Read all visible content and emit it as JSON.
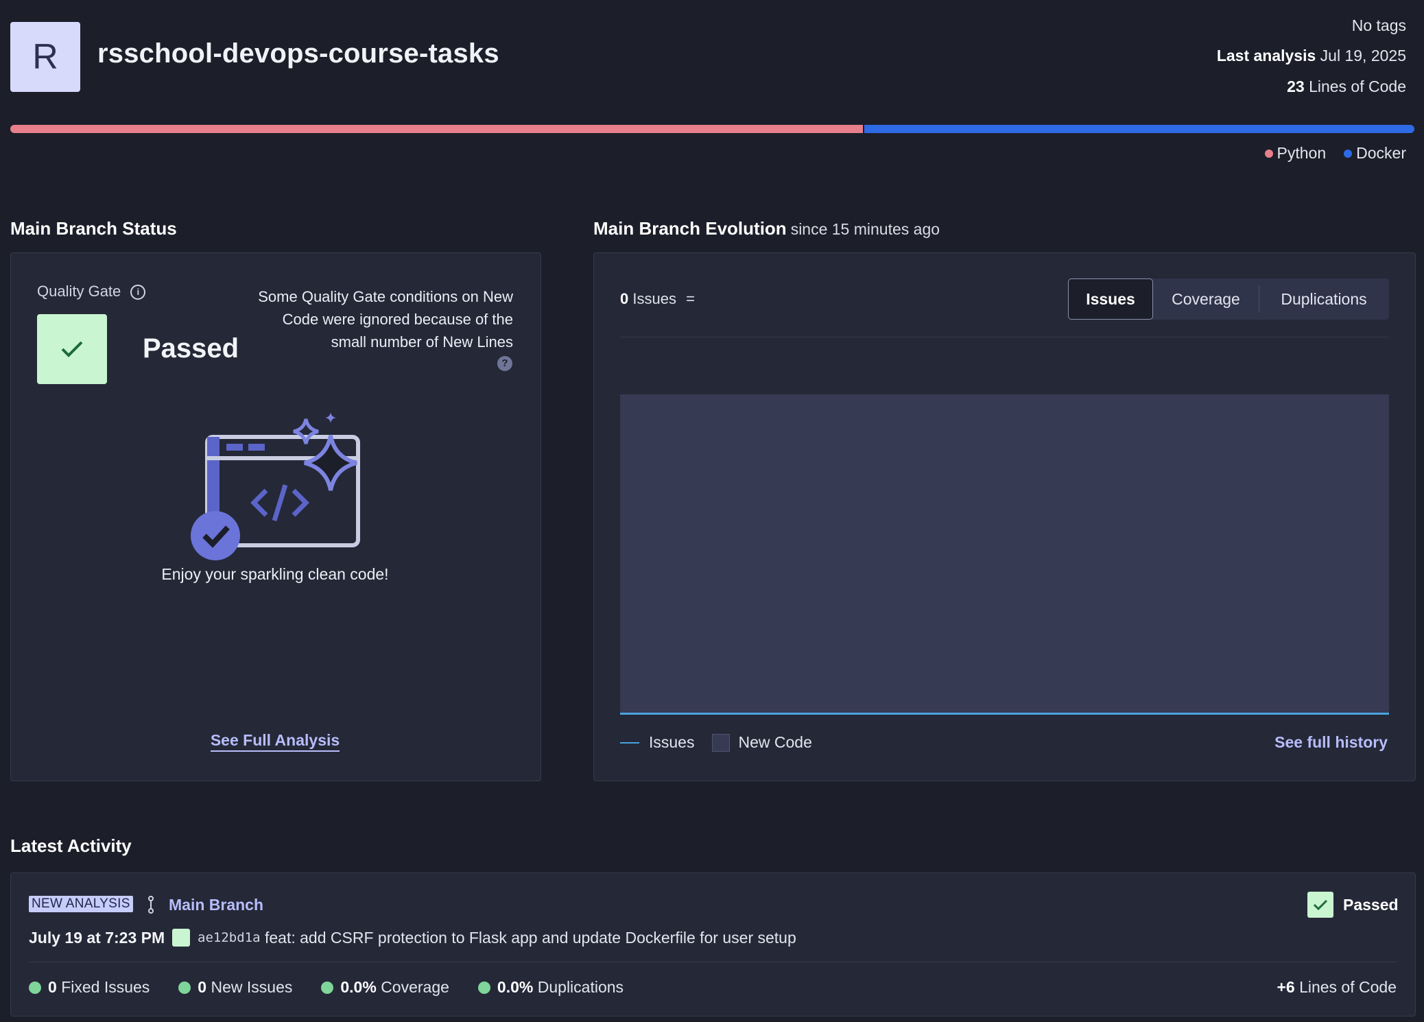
{
  "header": {
    "avatar_letter": "R",
    "project_name": "rsschool-devops-course-tasks",
    "tags": "No tags",
    "last_analysis_label": "Last analysis",
    "last_analysis_date": "Jul 19, 2025",
    "lines_of_code_value": "23",
    "lines_of_code_label": "Lines of Code"
  },
  "languages": [
    {
      "name": "Python",
      "color": "#e8808c",
      "share": 0.608
    },
    {
      "name": "Docker",
      "color": "#2f6ae6",
      "share": 0.392
    }
  ],
  "status": {
    "section_title": "Main Branch Status",
    "quality_gate_label": "Quality Gate",
    "info_icon": "i",
    "result": "Passed",
    "note": "Some Quality Gate conditions on New Code were ignored because of the small number of New Lines",
    "help_icon": "?",
    "illustration_caption": "Enjoy your sparkling clean code!",
    "see_full_analysis": "See Full Analysis"
  },
  "evolution": {
    "section_title": "Main Branch Evolution",
    "since": "since 15 minutes ago",
    "issues_value": "0",
    "issues_label": "Issues",
    "issues_suffix": "=",
    "tabs": [
      {
        "label": "Issues",
        "active": true
      },
      {
        "label": "Coverage",
        "active": false
      },
      {
        "label": "Duplications",
        "active": false
      }
    ],
    "legend_issues": "Issues",
    "legend_new_code": "New Code",
    "see_full_history": "See full history"
  },
  "chart_data": {
    "type": "area",
    "series": [
      {
        "name": "Issues",
        "values": [
          0
        ]
      }
    ],
    "title": "",
    "xlabel": "",
    "ylabel": "",
    "grid": false,
    "legend": "bottom-left"
  },
  "activity": {
    "section_title": "Latest Activity",
    "badge": "NEW ANALYSIS",
    "branch": "Main Branch",
    "result": "Passed",
    "date": "July 19 at 7:23 PM",
    "commit_hash": "ae12bd1a",
    "commit_message": "feat: add CSRF protection to Flask app and update Dockerfile for user setup",
    "metrics": {
      "fixed_value": "0",
      "fixed_label": "Fixed Issues",
      "new_value": "0",
      "new_label": "New Issues",
      "coverage_value": "0.0%",
      "coverage_label": "Coverage",
      "dup_value": "0.0%",
      "dup_label": "Duplications"
    },
    "loc_added_value": "+6",
    "loc_added_label": "Lines of Code"
  },
  "colors": {
    "passed_bg": "#c9f5d0",
    "accent_link": "#b7bdfa",
    "chart_line": "#4aa3df"
  }
}
